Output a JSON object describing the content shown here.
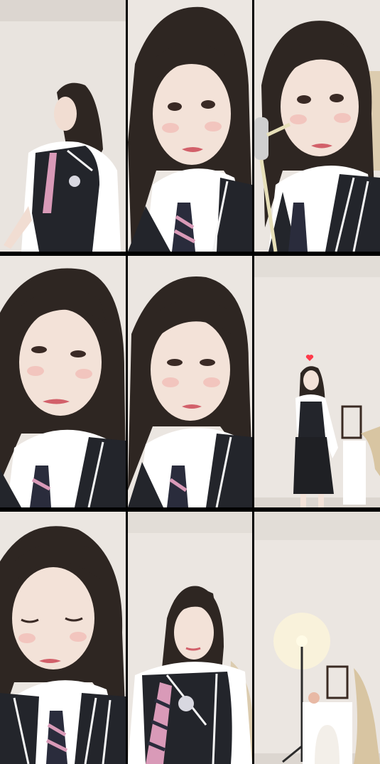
{
  "grid": {
    "rows": 3,
    "columns": 3,
    "background_color": "#000000"
  },
  "palette": {
    "wall": "#ebe6e1",
    "hair": "#2e2622",
    "skin": "#f3e2d8",
    "shirt": "#ffffff",
    "vest": "#23252b",
    "vest_stripe": "#f4f4f4",
    "tie": "#2a2c3c",
    "tie_stripe": "#d99ab8",
    "lips": "#d2606a",
    "blush": "#f1b9b3",
    "lamp_glow": "#fff6d8",
    "heart": "#ff3a4a",
    "decor_wood": "#3a2a22",
    "dried_grass": "#d8c5a2"
  },
  "tiles": [
    {
      "id": "tile-1",
      "scene": "side-turn"
    },
    {
      "id": "tile-2",
      "scene": "closeup"
    },
    {
      "id": "tile-3",
      "scene": "closeup-mic"
    },
    {
      "id": "tile-4",
      "scene": "closeup-tilt"
    },
    {
      "id": "tile-5",
      "scene": "closeup"
    },
    {
      "id": "tile-6",
      "scene": "full-body-dance"
    },
    {
      "id": "tile-7",
      "scene": "closeup-eyes-closed"
    },
    {
      "id": "tile-8",
      "scene": "mid-shot"
    },
    {
      "id": "tile-9",
      "scene": "empty-room-lamp"
    }
  ]
}
